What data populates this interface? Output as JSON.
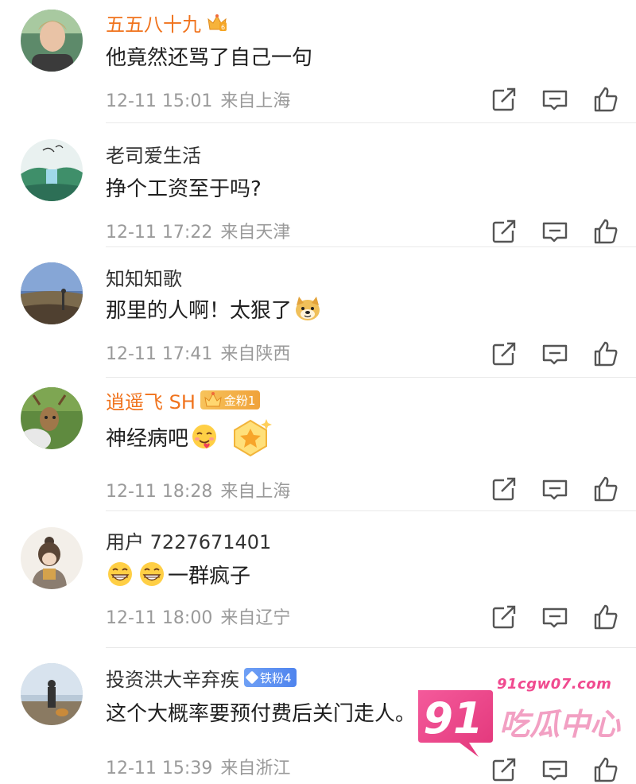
{
  "comments": [
    {
      "username": "五五八十九",
      "vip": true,
      "badge": "",
      "content": "他竟然还骂了自己一句",
      "time": "12-11 15:01",
      "location": "来自上海"
    },
    {
      "username": "老司爱生活",
      "vip": false,
      "badge": "",
      "content": "挣个工资至于吗?",
      "time": "12-11 17:22",
      "location": "来自天津"
    },
    {
      "username": "知知知歌",
      "vip": false,
      "badge": "",
      "content": "那里的人啊！太狠了",
      "time": "12-11 17:41",
      "location": "来自陕西"
    },
    {
      "username": "逍遥飞 SH",
      "vip": true,
      "badge": "金粉1",
      "content": "神经病吧",
      "time": "12-11 18:28",
      "location": "来自上海"
    },
    {
      "username": "用户 7227671401",
      "vip": false,
      "badge": "",
      "content": "一群疯子",
      "time": "12-11 18:00",
      "location": "来自辽宁"
    },
    {
      "username": "投资洪大辛弃疾",
      "vip": false,
      "badge": "铁粉4",
      "content": "这个大概率要预付费后关门走人。",
      "time": "12-11 15:39",
      "location": "来自浙江"
    }
  ],
  "icons": {
    "repost": "repost-icon",
    "comment": "comment-icon",
    "like": "like-icon"
  },
  "colors": {
    "vip_name": "#f0731d",
    "meta": "#9a9a9a",
    "icon": "#555555",
    "gold_badge": "#f0a23a",
    "iron_badge": "#4f84ee"
  },
  "watermark": {
    "logo_text": "91",
    "url": "91cgw07.com",
    "title": "吃瓜中心"
  }
}
